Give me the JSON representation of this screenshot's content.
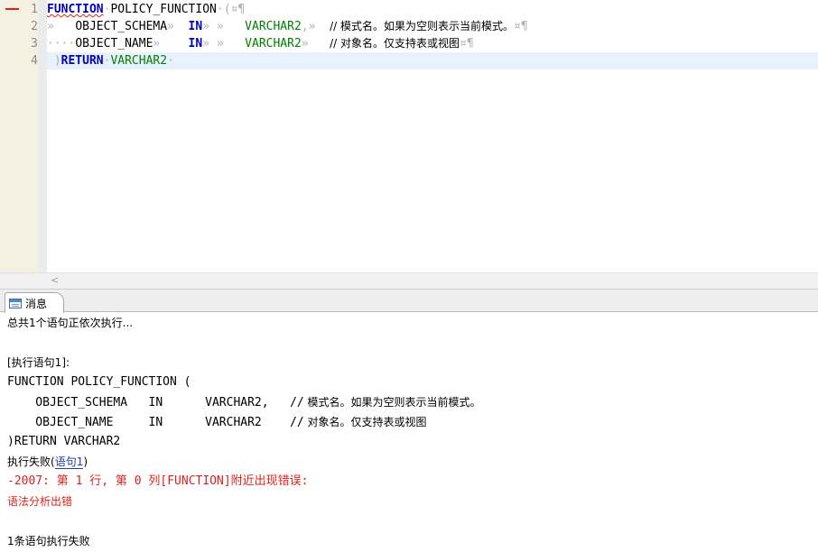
{
  "editor": {
    "line_numbers": [
      "1",
      "2",
      "3",
      "4"
    ],
    "lines": [
      {
        "kw": "FUNCTION",
        "name": "POLICY_FUNCTION",
        "paren": "(",
        "marks": "¤¶"
      },
      {
        "name": "OBJECT_SCHEMA",
        "mode": "IN",
        "type": "VARCHAR2",
        "comma": ",",
        "comment": "// 模式名。如果为空则表示当前模式。",
        "marks": "¤¶"
      },
      {
        "lead": "····",
        "name": "OBJECT_NAME",
        "mode": "IN",
        "type": "VARCHAR2",
        "comment": "// 对象名。仅支持表或视图",
        "marks": "¤¶"
      },
      {
        "paren": ")",
        "kw": "RETURN",
        "type": "VARCHAR2"
      }
    ]
  },
  "panel": {
    "tab_label": "消息"
  },
  "messages": {
    "summary": "总共1个语句正依次执行...",
    "exec_header": "[执行语句1]:",
    "code_l1": "FUNCTION POLICY_FUNCTION (",
    "code_l2_code": "    OBJECT_SCHEMA   IN      VARCHAR2,   //",
    "code_l2_comment": " 模式名。如果为空则表示当前模式。",
    "code_l3_code": "    OBJECT_NAME     IN      VARCHAR2    //",
    "code_l3_comment": " 对象名。仅支持表或视图",
    "code_l4": ")RETURN VARCHAR2",
    "fail_prefix": "执行失败(",
    "fail_link": "语句1",
    "fail_suffix": ")",
    "error_code": "-2007: 第 1 行, 第 0 列[FUNCTION]附近出现错误:",
    "error_detail": "语法分析出错",
    "footer": "1条语句执行失败"
  },
  "colors": {
    "keyword": "#0000c0",
    "type": "#008000",
    "error": "#e0201c",
    "link": "#1a3ea8"
  }
}
